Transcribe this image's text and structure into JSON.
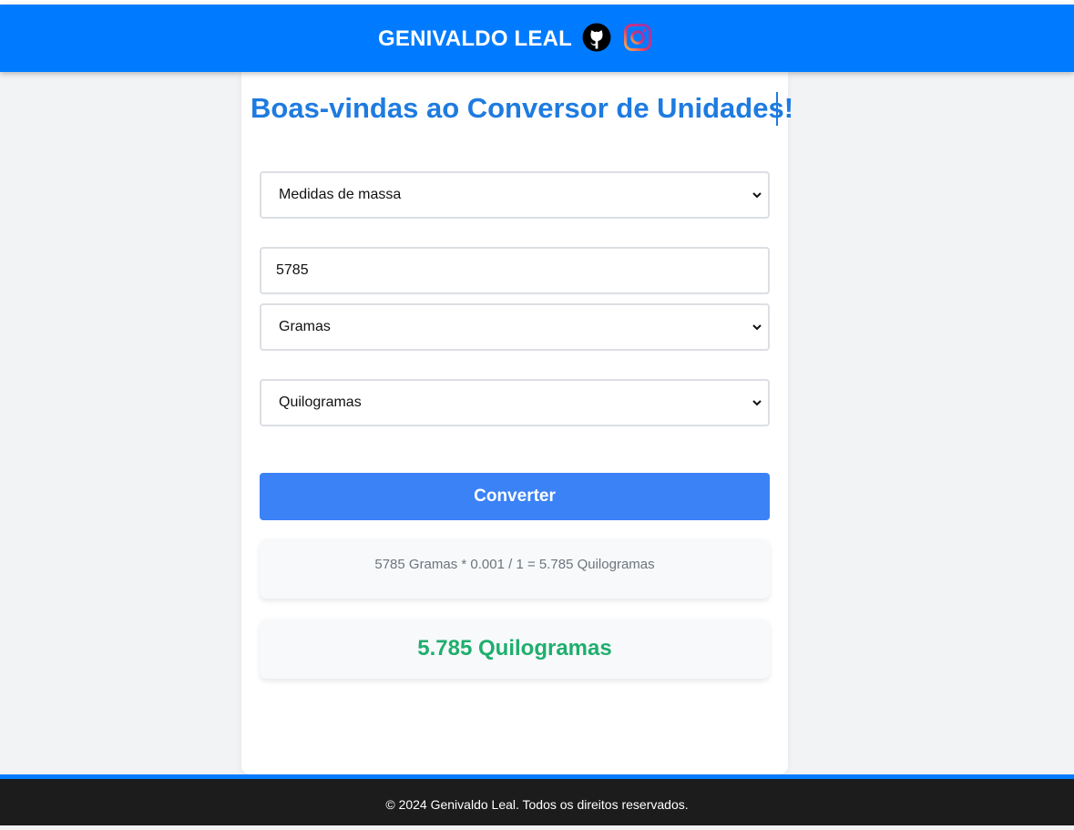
{
  "header": {
    "brand": "GENIVALDO LEAL",
    "icons": [
      "github-icon",
      "instagram-icon"
    ]
  },
  "main": {
    "title": "Boas-vindas ao Conversor de Unidades!",
    "category_select": {
      "selected": "Medidas de massa"
    },
    "value_input": {
      "value": "5785"
    },
    "from_unit_select": {
      "selected": "Gramas"
    },
    "to_unit_select": {
      "selected": "Quilogramas"
    },
    "convert_label": "Converter",
    "formula": "5785 Gramas * 0.001 / 1 = 5.785 Quilogramas",
    "result": "5.785 Quilogramas"
  },
  "footer": {
    "text": "© 2024 Genivaldo Leal. Todos os direitos reservados."
  },
  "colors": {
    "header_bg": "#007bff",
    "title": "#1e7be0",
    "button": "#3b82f6",
    "result": "#1fae6e",
    "footer_bg": "#1c1c1c"
  }
}
